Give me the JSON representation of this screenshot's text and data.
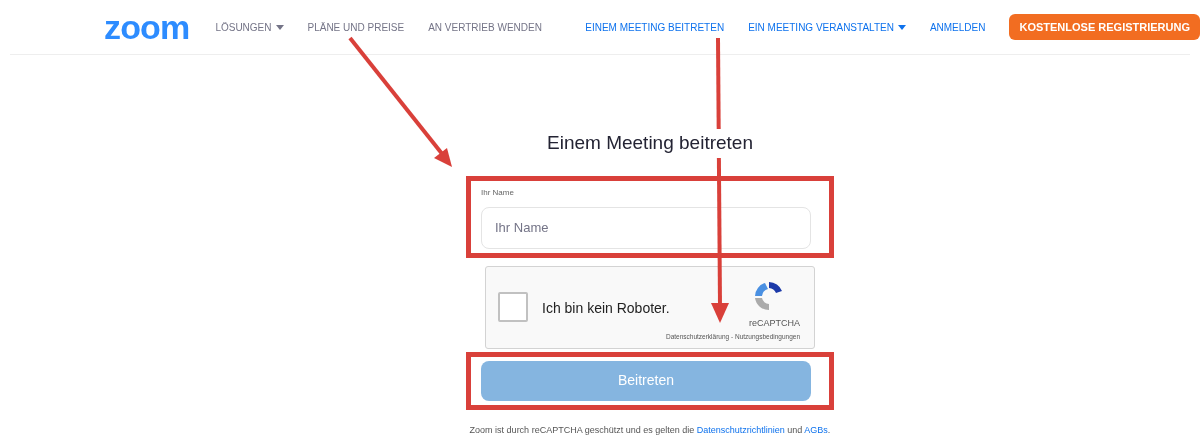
{
  "header": {
    "logo": "zoom",
    "nav_left": [
      {
        "label": "LÖSUNGEN",
        "dropdown": true
      },
      {
        "label": "PLÄNE UND PREISE",
        "dropdown": false
      },
      {
        "label": "AN VERTRIEB WENDEN",
        "dropdown": false
      }
    ],
    "nav_right": [
      {
        "label": "EINEM MEETING BEITRETEN",
        "dropdown": false
      },
      {
        "label": "EIN MEETING VERANSTALTEN",
        "dropdown": true
      },
      {
        "label": "ANMELDEN",
        "dropdown": false
      }
    ],
    "cta": "KOSTENLOSE REGISTRIERUNG"
  },
  "form": {
    "title": "Einem Meeting beitreten",
    "name_field": {
      "label": "Ihr Name",
      "placeholder": "Ihr Name",
      "highlighted": true
    },
    "captcha": {
      "label": "Ich bin kein Roboter.",
      "checked": false,
      "brand": "reCAPTCHA",
      "links": "Datenschutzerklärung - Nutzungsbedingungen"
    },
    "submit": {
      "label": "Beitreten",
      "disabled": true,
      "highlighted": true
    },
    "footer": {
      "text_1": "Zoom ist durch reCAPTCHA geschützt und es gelten die",
      "link_1": "Datenschutzrichtlinien",
      "text_2": "und",
      "link_2": "AGBs",
      "text_3": "."
    }
  }
}
